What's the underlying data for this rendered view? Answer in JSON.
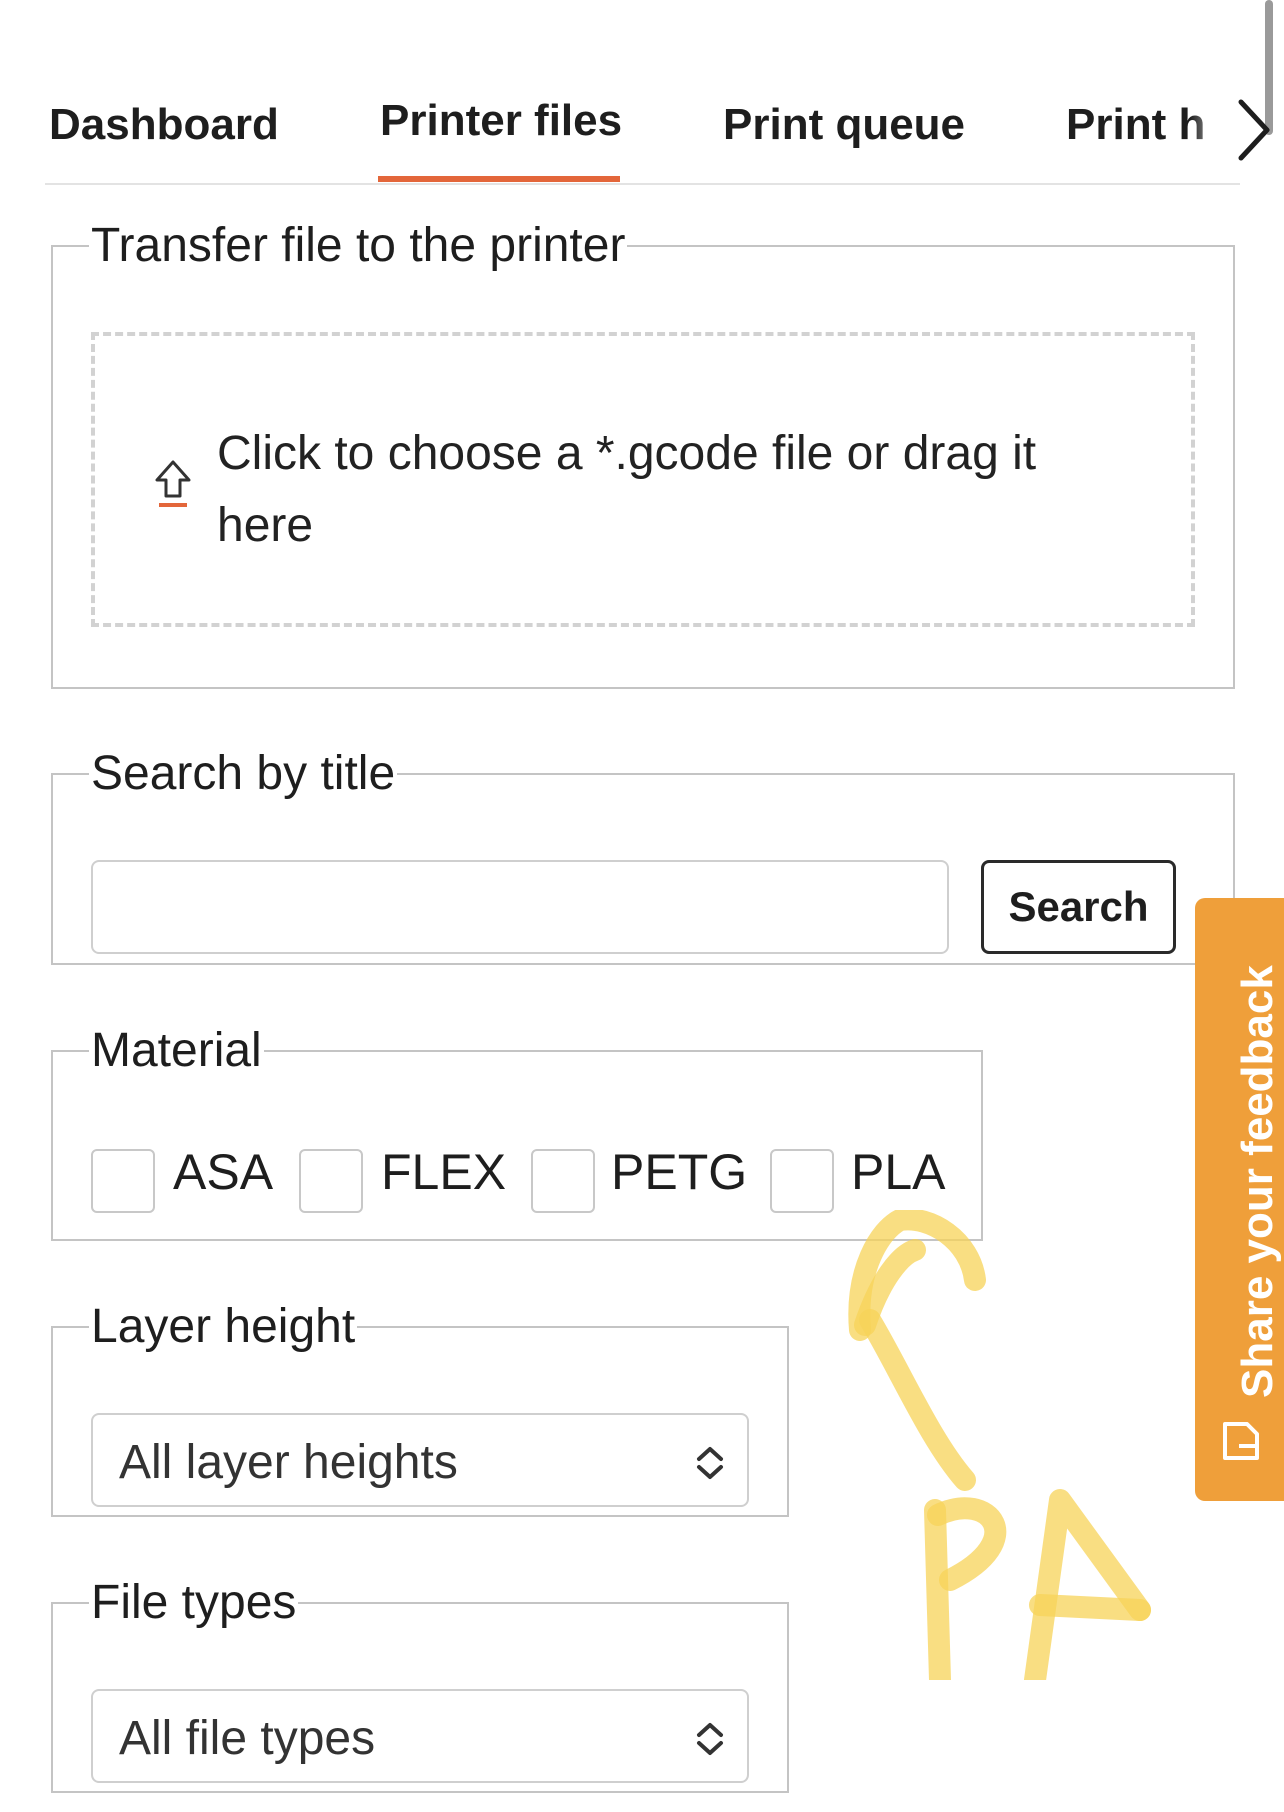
{
  "tabs": [
    {
      "label": "Dashboard",
      "active": false
    },
    {
      "label": "Printer files",
      "active": true
    },
    {
      "label": "Print queue",
      "active": false
    },
    {
      "label": "Print h",
      "active": false
    }
  ],
  "accent_color": "#e3663a",
  "transfer": {
    "legend": "Transfer file to the printer",
    "dropzone_text": "Click to choose a *.gcode file or drag it here",
    "icon": "upload-icon"
  },
  "search": {
    "legend": "Search by title",
    "value": "",
    "placeholder": "",
    "button_label": "Search"
  },
  "material": {
    "legend": "Material",
    "options": [
      {
        "label": "ASA",
        "checked": false
      },
      {
        "label": "FLEX",
        "checked": false
      },
      {
        "label": "PETG",
        "checked": false
      },
      {
        "label": "PLA",
        "checked": false
      }
    ]
  },
  "layer_height": {
    "legend": "Layer height",
    "selected": "All layer heights"
  },
  "file_types": {
    "legend": "File types",
    "selected": "All file types"
  },
  "feedback": {
    "label": "Share your feedback",
    "color": "#ef9f3a",
    "icon": "feedback-icon"
  },
  "annotation": {
    "text": "PA",
    "color": "#f7d358"
  }
}
